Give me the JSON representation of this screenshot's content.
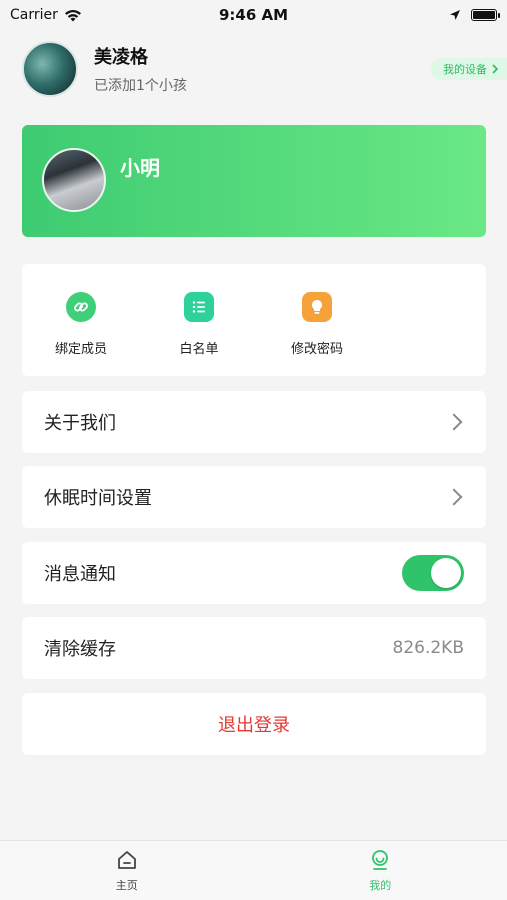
{
  "status_bar": {
    "carrier": "Carrier",
    "time": "9:46 AM"
  },
  "profile": {
    "name": "美凌格",
    "subtitle": "已添加1个小孩",
    "device_chip": "我的设备"
  },
  "child": {
    "name": "小明"
  },
  "actions": [
    {
      "label": "绑定成员",
      "icon": "link-icon"
    },
    {
      "label": "白名单",
      "icon": "list-icon"
    },
    {
      "label": "修改密码",
      "icon": "lightbulb-icon"
    }
  ],
  "settings": {
    "about_label": "关于我们",
    "sleep_label": "休眠时间设置",
    "notify_label": "消息通知",
    "notify_on": true,
    "cache_label": "清除缓存",
    "cache_value": "826.2KB",
    "logout_label": "退出登录"
  },
  "tabs": [
    {
      "label": "主页",
      "icon": "home-icon",
      "active": false
    },
    {
      "label": "我的",
      "icon": "profile-icon",
      "active": true
    }
  ],
  "colors": {
    "accent": "#2fc36a",
    "danger": "#e53935",
    "card_gradient_start": "#3ecb72",
    "card_gradient_end": "#6ae885"
  }
}
